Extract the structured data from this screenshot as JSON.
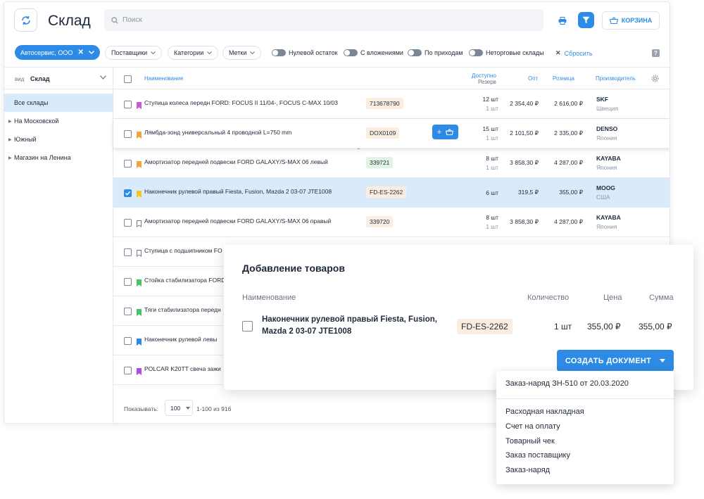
{
  "header": {
    "title": "Склад",
    "search_placeholder": "Поиск",
    "cart_label": "КОРЗИНА"
  },
  "filters": {
    "main_chip": "Автосервис, ООО",
    "chips": [
      "Поставщики",
      "Категории",
      "Метки"
    ],
    "toggles": [
      "Нулевой остаток",
      "С вложениями",
      "По приходам",
      "Неторговые склады"
    ],
    "reset": "Сбросить",
    "help": "?"
  },
  "sidebar": {
    "view_label": "вид",
    "view_value": "Склад",
    "items": [
      "Все склады",
      "На Московской",
      "Южный",
      "Магазин на Ленина"
    ]
  },
  "table": {
    "headers": {
      "name": "Наименование",
      "avail": "Доступно",
      "reserve": "Резерв",
      "opt": "Опт",
      "retail": "Розница",
      "mfr": "Производитель"
    },
    "rows": [
      {
        "name": "Ступица колеса передн FORD: FOCUS II 11/04-, FOCUS C-MAX 10/03",
        "sku": "713678790",
        "avail": "12 шт",
        "reserve": "1 шт",
        "opt": "2 354,40 ₽",
        "retail": "2 616,00 ₽",
        "mfr": "SKF",
        "country": "Швеция"
      },
      {
        "name": "Лямбда-зонд универсальный 4 проводной L=750 mm",
        "sku": "DOX0109",
        "avail": "15 шт",
        "reserve": "1 шт",
        "opt": "2 101,50 ₽",
        "retail": "2 335,00 ₽",
        "mfr": "DENSO",
        "country": "Япония"
      },
      {
        "name": "Амортизатор передней подвески FORD GALAXY/S-MAX 06 левый",
        "sku": "339721",
        "avail": "8 шт",
        "reserve": "1 шт",
        "opt": "3 858,30 ₽",
        "retail": "4 287,00 ₽",
        "mfr": "KAYABA",
        "country": "Япония"
      },
      {
        "name": "Наконечник рулевой правый Fiesta, Fusion, Mazda 2 03-07 JTE1008",
        "sku": "FD-ES-2262",
        "avail": "6 шт",
        "reserve": "",
        "opt": "319,5 ₽",
        "retail": "355,00 ₽",
        "mfr": "MOOG",
        "country": "США"
      },
      {
        "name": "Амортизатор передней подвески FORD GALAXY/S-MAX 06 правый",
        "sku": "339720",
        "avail": "8 шт",
        "reserve": "1 шт",
        "opt": "3 858,30 ₽",
        "retail": "4 287,00 ₽",
        "mfr": "KAYABA",
        "country": "Япония"
      },
      {
        "name": "Ступица с подшипником FO",
        "sku": "",
        "avail": "",
        "reserve": "",
        "opt": "",
        "retail": "",
        "mfr": "",
        "country": ""
      },
      {
        "name": "Стойка стабилизатора FORD",
        "sku": "",
        "avail": "",
        "reserve": "",
        "opt": "",
        "retail": "",
        "mfr": "",
        "country": ""
      },
      {
        "name": "Тяги стабилизатора передн",
        "sku": "",
        "avail": "",
        "reserve": "",
        "opt": "",
        "retail": "",
        "mfr": "",
        "country": ""
      },
      {
        "name": "Наконечник рулевой левы",
        "sku": "",
        "avail": "",
        "reserve": "",
        "opt": "",
        "retail": "",
        "mfr": "",
        "country": ""
      },
      {
        "name": "POLCAR K20TT свеча зажи",
        "sku": "",
        "avail": "",
        "reserve": "",
        "opt": "",
        "retail": "",
        "mfr": "",
        "country": ""
      }
    ]
  },
  "footer": {
    "show_label": "Показывать:",
    "page_size": "100",
    "range": "1-100 из 916"
  },
  "modal": {
    "title": "Добавление товаров",
    "headers": {
      "name": "Наименование",
      "qty": "Количество",
      "price": "Цена",
      "sum": "Сумма"
    },
    "item": {
      "name": "Наконечник рулевой правый Fiesta, Fusion, Mazda 2 03-07 JTE1008",
      "sku": "FD-ES-2262",
      "qty": "1 шт",
      "price": "355,00 ₽",
      "sum": "355,00 ₽"
    },
    "create_label": "СОЗДАТЬ ДОКУМЕНТ"
  },
  "dropdown": {
    "top_item": "Заказ-наряд ЗН-510 от 20.03.2020",
    "items": [
      "Расходная накладная",
      "Счет на оплату",
      "Товарный чек",
      "Заказ поставщику",
      "Заказ-наряд"
    ]
  },
  "colors": {
    "accent": "#2d8be6",
    "selected_row": "#d9eafb",
    "flags": [
      "#c75bd6",
      "#f2a33a",
      "#f2a33a",
      "#f2c71b",
      "outline",
      "outline",
      "#47c46a",
      "#47c46a",
      "#2d8be6",
      "#b04de0"
    ],
    "sku_bg": [
      "#fbeee0",
      "#fbeee0",
      "#e1f3e4",
      "#fbeee0",
      "#fbeee0"
    ]
  }
}
